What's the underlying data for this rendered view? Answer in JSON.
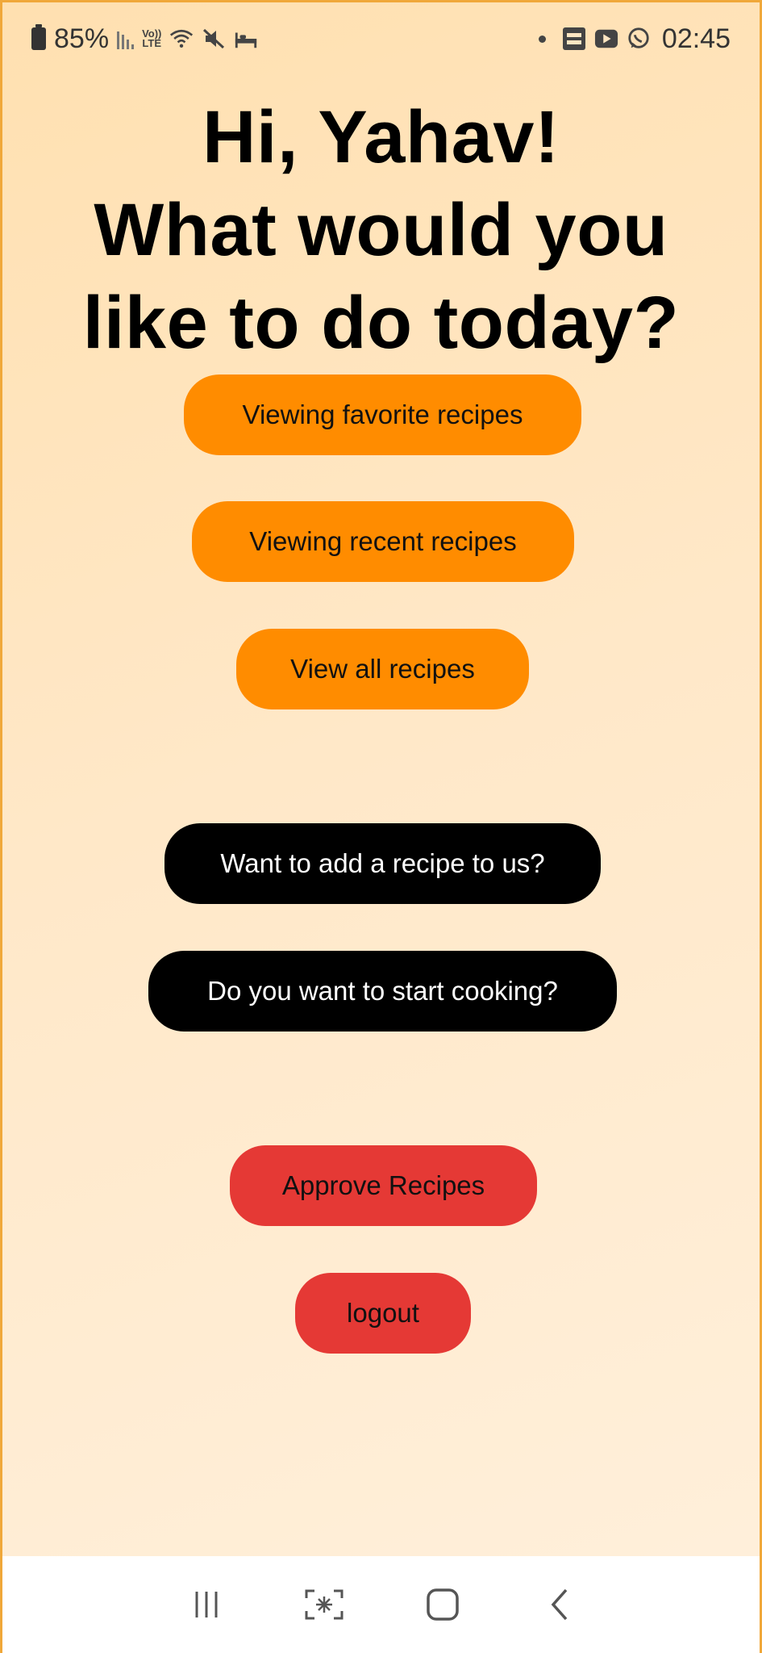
{
  "status_bar": {
    "battery_percent": "85%",
    "volte_top": "Vo))",
    "volte_bottom": "LTE",
    "time": "02:45",
    "icons": [
      "battery-icon",
      "signal-icon",
      "volte-icon",
      "wifi-icon",
      "mute-icon",
      "bed-icon",
      "notification-dot-icon",
      "news-icon",
      "youtube-icon",
      "whatsapp-icon"
    ]
  },
  "title": {
    "line1": "Hi, Yahav!",
    "line2": "What would you",
    "line3": "like to do today?"
  },
  "buttons": {
    "favorites": "Viewing favorite recipes",
    "recent": "Viewing recent recipes",
    "all": "View all recipes",
    "add_recipe": "Want to add a recipe to us?",
    "start_cooking": "Do you want to start cooking?",
    "approve": "Approve Recipes",
    "logout": "logout"
  },
  "colors": {
    "orange": "#ff8c00",
    "black": "#000000",
    "red": "#e53935",
    "background": "#ffe6c2"
  },
  "nav_bar": {
    "icons": [
      "recents-icon",
      "capture-icon",
      "home-icon",
      "back-icon"
    ]
  }
}
